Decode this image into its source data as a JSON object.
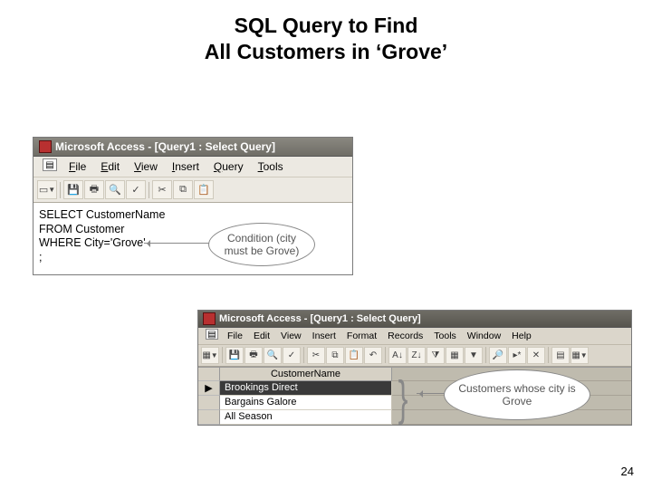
{
  "title_line1": "SQL Query to Find",
  "title_line2": "All Customers in ‘Grove’",
  "page_number": "24",
  "win1": {
    "title": "Microsoft Access - [Query1 : Select Query]",
    "menu": {
      "file": "File",
      "edit": "Edit",
      "view": "View",
      "insert": "Insert",
      "query": "Query",
      "tools": "Tools"
    },
    "sql_lines": [
      "SELECT CustomerName",
      "FROM Customer",
      "WHERE City='Grove'",
      ";"
    ]
  },
  "callout1_text": "Condition (city must be Grove)",
  "win2": {
    "title": "Microsoft Access - [Query1 : Select Query]",
    "menu": {
      "file": "File",
      "edit": "Edit",
      "view": "View",
      "insert": "Insert",
      "format": "Format",
      "records": "Records",
      "tools": "Tools",
      "window": "Window",
      "help": "Help"
    },
    "column_header": "CustomerName",
    "rows": [
      "Brookings Direct",
      "Bargains Galore",
      "All Season"
    ]
  },
  "callout2_text": "Customers whose city is Grove",
  "icons": {
    "app": "access-app-icon",
    "doc": "document-icon"
  }
}
